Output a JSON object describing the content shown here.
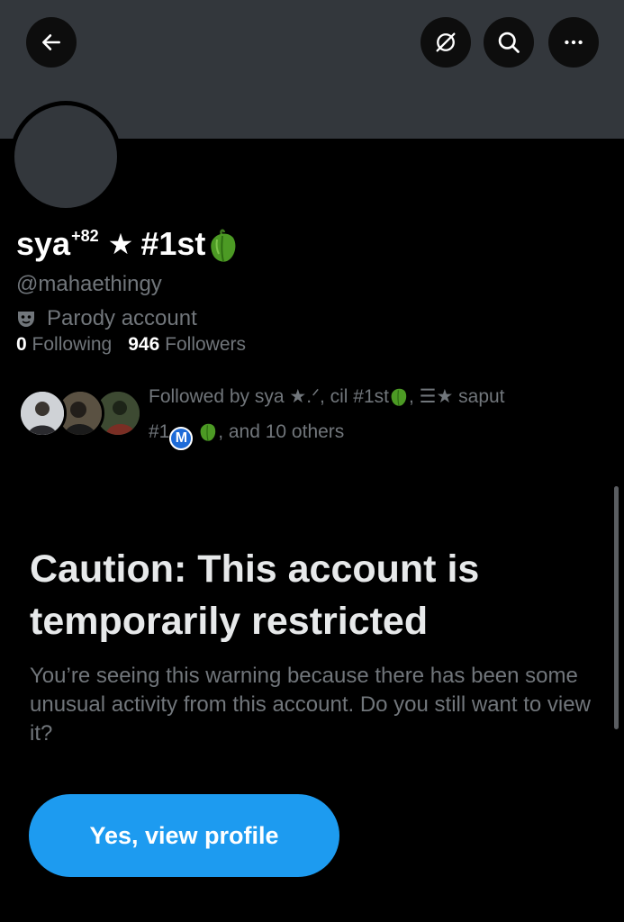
{
  "header": {
    "back_icon": "arrow-left-icon",
    "translate_icon": "translate-off-icon",
    "search_icon": "search-icon",
    "more_icon": "more-horizontal-icon"
  },
  "profile": {
    "name": "sya",
    "name_superscript": "+82",
    "name_star": "★",
    "name_rank": "#1st",
    "name_emoji": "green-pepper-icon",
    "handle": "@mahaethingy",
    "parody_label": "Parody account",
    "following_count": "0",
    "following_label": "Following",
    "followers_count": "946",
    "followers_label": "Followers"
  },
  "followed_by": {
    "prefix": "Followed by sya ★.ᐟ, cil #1st",
    "part2": ", ☰★ saput",
    "part3": "#1",
    "m_badge": "M",
    "suffix": ", and 10 others"
  },
  "caution": {
    "title": "Caution: This account is temporarily restricted",
    "body": "You’re seeing this warning because there has been some unusual activity from this account. Do you still want to view it?",
    "button_label": "Yes, view profile"
  },
  "colors": {
    "accent": "#1d9bf0",
    "banner": "#33373c",
    "muted_text": "#71767b",
    "background": "#000000"
  }
}
